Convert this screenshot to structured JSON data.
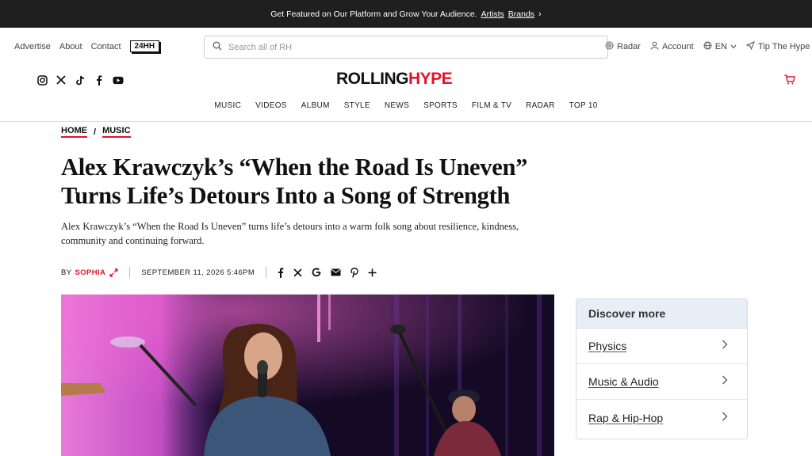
{
  "promo": {
    "text": "Get Featured on Our Platform and Grow Your Audience.",
    "link1": "Artists",
    "link2": "Brands",
    "chevron": "›"
  },
  "util": {
    "left": [
      "Advertise",
      "About",
      "Contact"
    ],
    "badge": "24HH",
    "search_placeholder": "Search all of RH",
    "radar": "Radar",
    "account": "Account",
    "lang": "EN",
    "tip": "Tip The Hype"
  },
  "logo": {
    "part1": "ROLLING",
    "part2": "HYPE"
  },
  "nav": [
    "MUSIC",
    "VIDEOS",
    "ALBUM",
    "STYLE",
    "NEWS",
    "SPORTS",
    "FILM & TV",
    "RADAR",
    "TOP 10"
  ],
  "breadcrumb": {
    "home": "HOME",
    "sep": "/",
    "section": "MUSIC"
  },
  "article": {
    "title": "Alex Krawczyk’s “When the Road Is Uneven” Turns Life’s Detours Into a Song of Strength",
    "dek": "Alex Krawczyk’s “When the Road Is Uneven” turns life’s detours into a warm folk song about resilience, kindness, community and continuing forward.",
    "by": "BY",
    "author": "SOPHIA",
    "date": "SEPTEMBER 11, 2026 5:46PM"
  },
  "share_icons": [
    "facebook-icon",
    "x-icon",
    "google-icon",
    "email-icon",
    "pinterest-icon",
    "plus-icon"
  ],
  "sidebar": {
    "title": "Discover more",
    "items": [
      {
        "label": "Physics"
      },
      {
        "label": "Music & Audio"
      },
      {
        "label": "Rap & Hip-Hop"
      }
    ]
  },
  "colors": {
    "accent": "#e0142b",
    "promo_bg": "#1f1f1f",
    "sidebar_header": "#e8eef6"
  }
}
